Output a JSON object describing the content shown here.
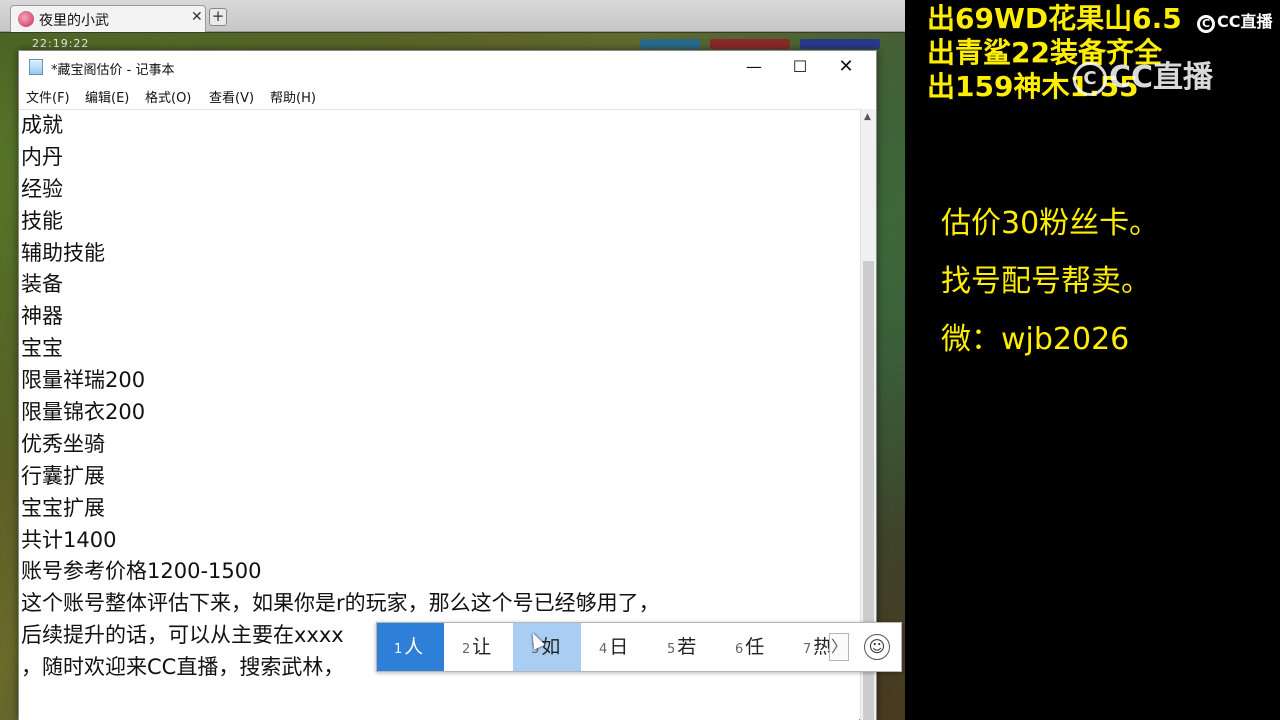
{
  "browser": {
    "tab_title": "夜里的小武",
    "tab_close": "✕",
    "new_tab": "+"
  },
  "game": {
    "clock": "22:19:22"
  },
  "notepad": {
    "title": "*藏宝阁估价 - 记事本",
    "window_controls": {
      "minimize": "—",
      "maximize": "☐",
      "close": "✕"
    },
    "menu": {
      "file": "文件(F)",
      "edit": "编辑(E)",
      "format": "格式(O)",
      "view": "查看(V)",
      "help": "帮助(H)"
    },
    "lines": [
      "成就",
      "内丹",
      "经验",
      "技能",
      "辅助技能",
      "装备",
      "神器",
      "宝宝",
      "限量祥瑞200",
      "限量锦衣200",
      "优秀坐骑",
      "行囊扩展",
      "宝宝扩展",
      "共计1400",
      "账号参考价格1200-1500",
      "这个账号整体评估下来，如果你是r的玩家，那么这个号已经够用了，",
      "后续提升的话，可以从主要在xxxx",
      "，随时欢迎来CC直播，搜索武林，"
    ]
  },
  "ime": {
    "candidates": [
      {
        "num": "1",
        "text": "人"
      },
      {
        "num": "2",
        "text": "让"
      },
      {
        "num": "3",
        "text": "如"
      },
      {
        "num": "4",
        "text": "日"
      },
      {
        "num": "5",
        "text": "若"
      },
      {
        "num": "6",
        "text": "任"
      },
      {
        "num": "7",
        "text": "热"
      }
    ],
    "next_icon": "chevron-right",
    "emoji_icon": "smiley",
    "emoji_glyph": "☺",
    "next_glyph": "〉"
  },
  "overlay": {
    "sale_lines": [
      "出69WD花果山6.5",
      "出青鲨22装备齐全",
      "出159神木1.55"
    ],
    "info_lines": [
      "估价30粉丝卡。",
      "找号配号帮卖。",
      "微：wjb2026"
    ],
    "logo_text": "CC直播",
    "logo_mark": "C",
    "accent_color": "#ffee00"
  }
}
